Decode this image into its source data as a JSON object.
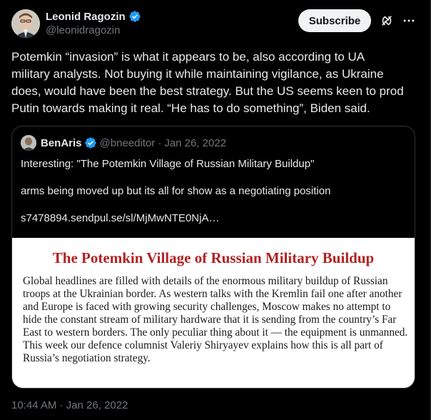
{
  "author": {
    "name": "Leonid Ragozin",
    "handle": "@leonidragozin",
    "avatar_icon": "person-avatar"
  },
  "actions": {
    "subscribe_label": "Subscribe",
    "grok_icon": "grok-icon",
    "more_icon": "more-horizontal-icon"
  },
  "tweet": {
    "text": "Potemkin “invasion” is what it appears to be, also according to UA\nmilitary analysts. Not buying it while maintaining vigilance, as Ukraine\ndoes, would have been the best strategy. But the US seems keen to prod\nPutin towards making it real. “He has to do something”, Biden said.",
    "timestamp": "10:44 AM · Jan 26, 2022"
  },
  "quote": {
    "name": "BenAris",
    "handle": "@bneeditor",
    "dot": "·",
    "date": "Jan 26, 2022",
    "line1": "Interesting: \"The Potemkin Village of Russian Military Buildup\"",
    "line2": "arms being moved up but its all for show as a negotiating position",
    "line3": "s7478894.sendpul.se/sl/MjMwNTE0NjA…"
  },
  "article": {
    "title": "The Potemkin Village of Russian Military Buildup",
    "body": "Global headlines are filled with details of the enormous military buildup of Russian troops at the Ukrainian border. As western talks with the Kremlin fail one after another and Europe is faced with growing security challenges, Moscow makes no attempt to hide the constant stream of military hardware that it is sending from the country’s Far East to western borders. The only peculiar thing about it — the equipment is unmanned. This week our defence columnist Valeriy Shiryayev explains how this is all part of Russia’s negotiation strategy."
  },
  "colors": {
    "background": "#000000",
    "text": "#e7e9ea",
    "muted": "#71767b",
    "verified": "#1d9bf0",
    "article_title": "#b22222"
  }
}
